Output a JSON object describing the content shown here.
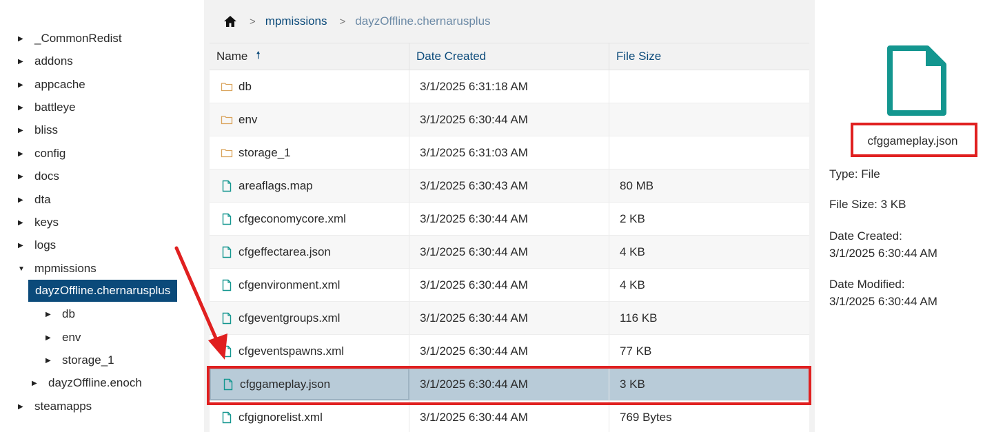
{
  "sidebar": {
    "items": [
      {
        "label": "_CommonRedist",
        "caret": "▶"
      },
      {
        "label": "addons",
        "caret": "▶"
      },
      {
        "label": "appcache",
        "caret": "▶"
      },
      {
        "label": "battleye",
        "caret": "▶"
      },
      {
        "label": "bliss",
        "caret": "▶"
      },
      {
        "label": "config",
        "caret": "▶"
      },
      {
        "label": "docs",
        "caret": "▶"
      },
      {
        "label": "dta",
        "caret": "▶"
      },
      {
        "label": "keys",
        "caret": "▶"
      },
      {
        "label": "logs",
        "caret": "▶"
      },
      {
        "label": "mpmissions",
        "caret": "▼"
      },
      {
        "label": "dayzOffline.chernarusplus",
        "caret": ""
      },
      {
        "label": "db",
        "caret": "▶"
      },
      {
        "label": "env",
        "caret": "▶"
      },
      {
        "label": "storage_1",
        "caret": "▶"
      },
      {
        "label": "dayzOffline.enoch",
        "caret": "▶"
      },
      {
        "label": "steamapps",
        "caret": "▶"
      }
    ]
  },
  "breadcrumb": {
    "home_icon": "home-icon",
    "items": [
      "mpmissions",
      "dayzOffline.chernarusplus"
    ]
  },
  "grid": {
    "headers": {
      "name": "Name",
      "date_created": "Date Created",
      "file_size": "File Size",
      "sort_indicator": "🠕"
    },
    "rows": [
      {
        "type": "folder",
        "name": "db",
        "date": "3/1/2025 6:31:18 AM",
        "size": ""
      },
      {
        "type": "folder",
        "name": "env",
        "date": "3/1/2025 6:30:44 AM",
        "size": ""
      },
      {
        "type": "folder",
        "name": "storage_1",
        "date": "3/1/2025 6:31:03 AM",
        "size": ""
      },
      {
        "type": "file",
        "name": "areaflags.map",
        "date": "3/1/2025 6:30:43 AM",
        "size": "80 MB"
      },
      {
        "type": "file",
        "name": "cfgeconomycore.xml",
        "date": "3/1/2025 6:30:44 AM",
        "size": "2 KB"
      },
      {
        "type": "file",
        "name": "cfgeffectarea.json",
        "date": "3/1/2025 6:30:44 AM",
        "size": "4 KB"
      },
      {
        "type": "file",
        "name": "cfgenvironment.xml",
        "date": "3/1/2025 6:30:44 AM",
        "size": "4 KB"
      },
      {
        "type": "file",
        "name": "cfgeventgroups.xml",
        "date": "3/1/2025 6:30:44 AM",
        "size": "116 KB"
      },
      {
        "type": "file",
        "name": "cfgeventspawns.xml",
        "date": "3/1/2025 6:30:44 AM",
        "size": "77 KB"
      },
      {
        "type": "file",
        "name": "cfggameplay.json",
        "date": "3/1/2025 6:30:44 AM",
        "size": "3 KB",
        "selected": true
      },
      {
        "type": "file",
        "name": "cfgignorelist.xml",
        "date": "3/1/2025 6:30:44 AM",
        "size": "769 Bytes"
      }
    ]
  },
  "details": {
    "icon": "file-icon",
    "name": "cfggameplay.json",
    "type": "Type: File",
    "size": "File Size: 3 KB",
    "created_label": "Date Created:",
    "created_value": "3/1/2025 6:30:44 AM",
    "modified_label": "Date Modified:",
    "modified_value": "3/1/2025 6:30:44 AM"
  },
  "colors": {
    "accent": "#0b4a7a",
    "selected_row": "#b8cbd8",
    "file_icon": "#13968f",
    "folder_icon": "#d9a35b",
    "annotation": "#e02020"
  }
}
